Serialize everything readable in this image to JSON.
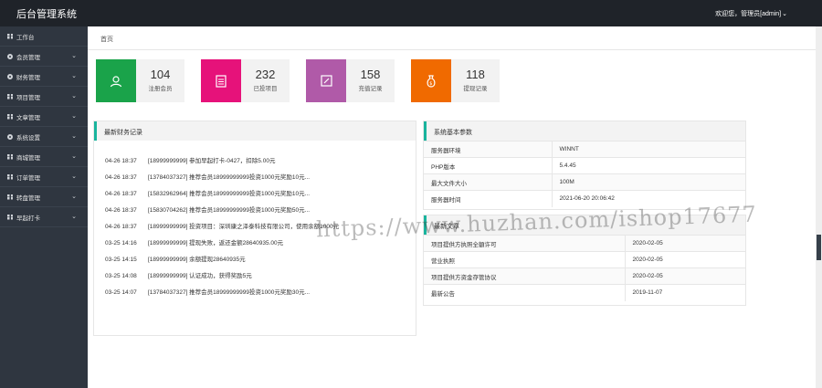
{
  "app": {
    "title": "后台管理系统"
  },
  "header": {
    "user": "欢迎您，管理员[admin]"
  },
  "sidebar": {
    "items": [
      {
        "label": "工作台",
        "icon": "grid-icon",
        "expandable": false
      },
      {
        "label": "会员管理",
        "icon": "gear-icon",
        "expandable": true
      },
      {
        "label": "财务管理",
        "icon": "gear-icon",
        "expandable": true
      },
      {
        "label": "项目管理",
        "icon": "grid-icon",
        "expandable": true
      },
      {
        "label": "文章管理",
        "icon": "grid-icon",
        "expandable": true
      },
      {
        "label": "系统设置",
        "icon": "gear-icon",
        "expandable": true
      },
      {
        "label": "商城管理",
        "icon": "grid-icon",
        "expandable": true
      },
      {
        "label": "订单管理",
        "icon": "grid-icon",
        "expandable": true
      },
      {
        "label": "转盘管理",
        "icon": "grid-icon",
        "expandable": true
      },
      {
        "label": "早起打卡",
        "icon": "grid-icon",
        "expandable": true
      }
    ]
  },
  "breadcrumb": {
    "home": "首页"
  },
  "stats": [
    {
      "value": "104",
      "label": "注册会员",
      "color": "#1aa34a",
      "icon": "user-icon"
    },
    {
      "value": "232",
      "label": "已投项目",
      "color": "#e6127a",
      "icon": "document-icon"
    },
    {
      "value": "158",
      "label": "充值记录",
      "color": "#b05aa8",
      "icon": "edit-icon"
    },
    {
      "value": "118",
      "label": "提现记录",
      "color": "#f06a00",
      "icon": "money-bag-icon"
    }
  ],
  "finance": {
    "title": "最新财务记录",
    "records": [
      {
        "time": "04-26 18:37",
        "text": "[18999999999] 参加早起打卡-0427，扣除5.00元"
      },
      {
        "time": "04-26 18:37",
        "text": "[13784037327] 推荐会员18999999999投资1000元奖励10元..."
      },
      {
        "time": "04-26 18:37",
        "text": "[15832962964] 推荐会员18999999999投资1000元奖励10元..."
      },
      {
        "time": "04-26 18:37",
        "text": "[15830704262] 推荐会员18999999999投资1000元奖励50元..."
      },
      {
        "time": "04-26 18:37",
        "text": "[18999999999] 投资项目：深圳康之泽泰科技有限公司，使用余额1000元"
      },
      {
        "time": "03-25 14:16",
        "text": "[18999999999] 提现失败，返还金额28640935.00元"
      },
      {
        "time": "03-25 14:15",
        "text": "[18999999999] 余额提现28640935元"
      },
      {
        "time": "03-25 14:08",
        "text": "[18999999999] 认证成功，获得奖励5元"
      },
      {
        "time": "03-25 14:07",
        "text": "[13784037327] 推荐会员18999999999投资1000元奖励30元..."
      }
    ]
  },
  "system": {
    "title": "系统基本参数",
    "rows": [
      {
        "key": "服务器环境",
        "value": "WINNT"
      },
      {
        "key": "PHP版本",
        "value": "5.4.45"
      },
      {
        "key": "最大文件大小",
        "value": "100M"
      },
      {
        "key": "服务器时间",
        "value": "2021-06-20 20:06:42"
      }
    ]
  },
  "articles": {
    "title": "最新文章",
    "rows": [
      {
        "title": "项目提供方执照全額许可",
        "date": "2020-02-05"
      },
      {
        "title": "营业执照",
        "date": "2020-02-05"
      },
      {
        "title": "项目提供方资金存管协议",
        "date": "2020-02-05"
      },
      {
        "title": "最新公告",
        "date": "2019-11-07"
      }
    ]
  },
  "watermark": "https://www.huzhan.com/ishop17677"
}
